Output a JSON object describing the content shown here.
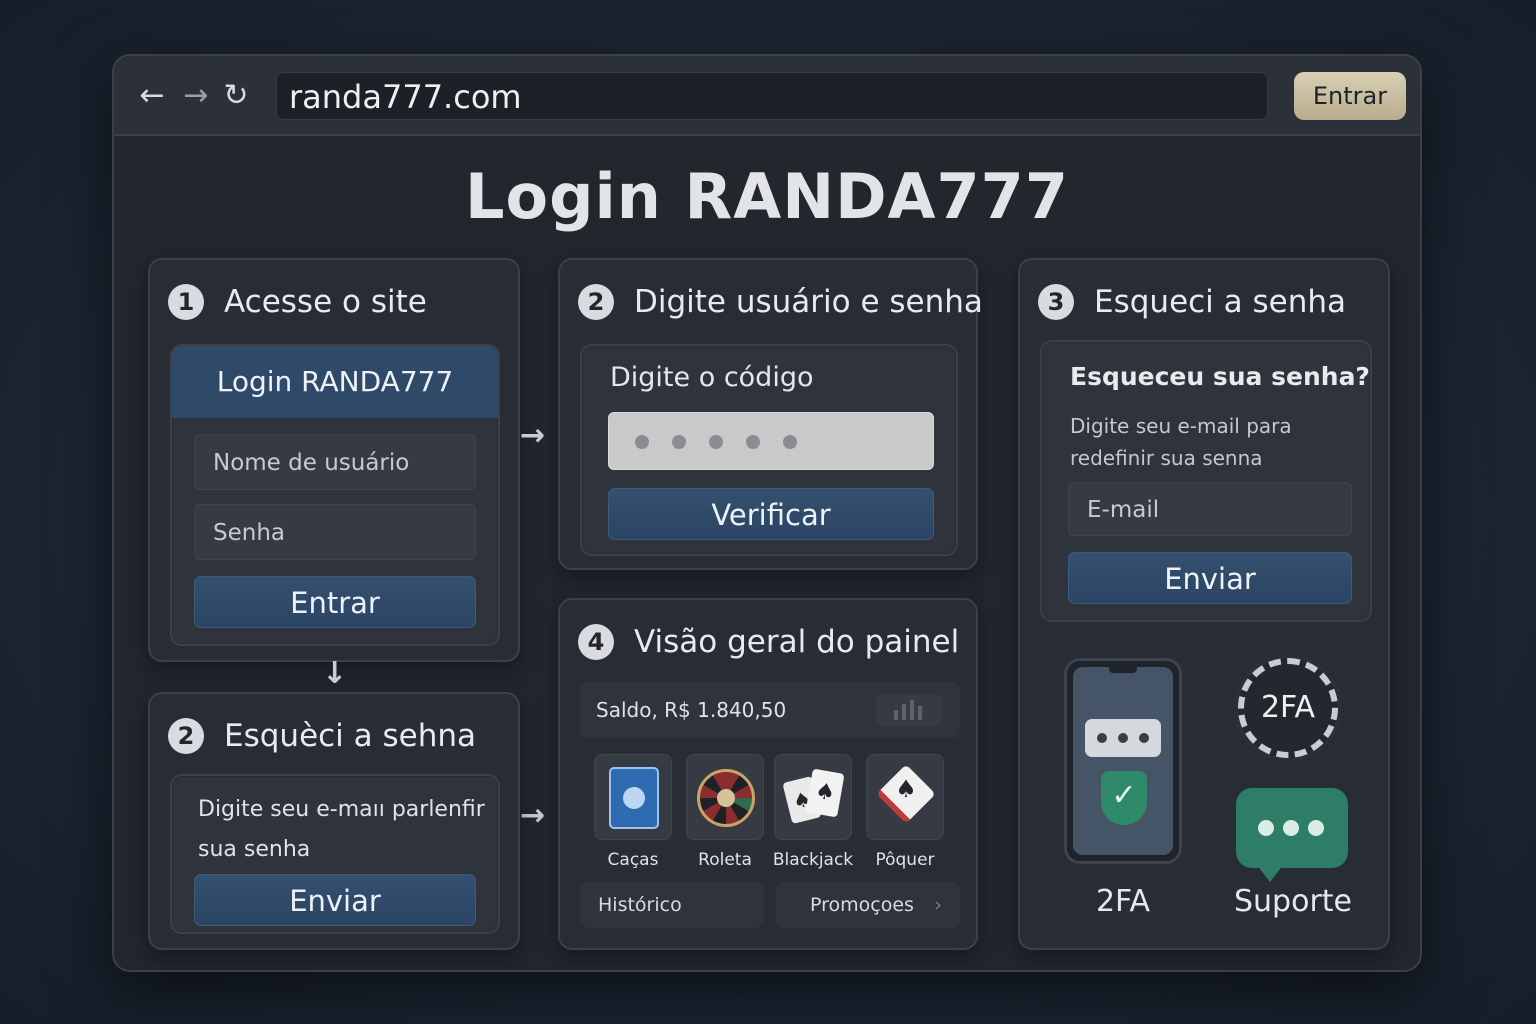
{
  "browser": {
    "url": "randa777.com",
    "login_label": "Entrar"
  },
  "page_title": "Login RANDA777",
  "step1": {
    "number": "1",
    "title": "Acesse o site",
    "panel_title": "Login RANDA777",
    "username_placeholder": "Nome de usuário",
    "password_placeholder": "Senha",
    "submit_label": "Entrar"
  },
  "step2a": {
    "number": "2",
    "title": "Digite usuário e senha",
    "code_label": "Digite o código",
    "verify_label": "Verificar"
  },
  "step2b": {
    "number": "2",
    "title": "Esquèci a sehna",
    "text": "Digite seu e-maıı parlenfir sua senha",
    "send_label": "Enviar"
  },
  "step3": {
    "number": "3",
    "title": "Esqueci a senha",
    "question": "Esqueceu sua senha?",
    "description": "Digite seu e-mail para redefinir sua senna",
    "email_placeholder": "E-mail",
    "send_label": "Enviar",
    "twofa_badge": "2FA",
    "twofa_label": "2FA",
    "support_label": "Suporte"
  },
  "step4": {
    "number": "4",
    "title": "Visão geral do painel",
    "balance": "Saldo, R$ 1.840,50",
    "games": [
      "Caças",
      "Roleta",
      "Blackjack",
      "Pôquer"
    ],
    "tabs": [
      "Histórico",
      "Promoçoes"
    ]
  },
  "colors": {
    "accent_blue": "#2f4a69",
    "support_green": "#2e7d66",
    "shield_green": "#2f8a6a",
    "login_gold": "#cfc5a6"
  }
}
